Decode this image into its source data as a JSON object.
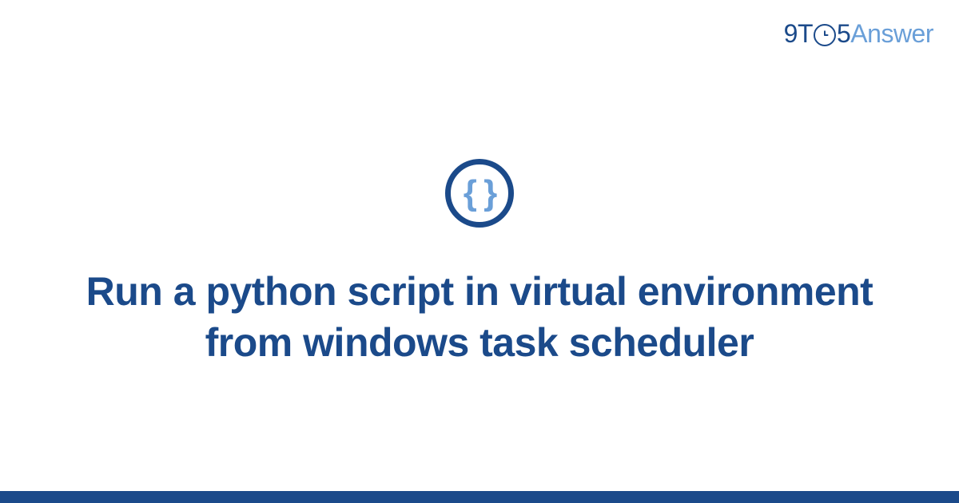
{
  "header": {
    "logo": {
      "part1": "9T",
      "clock_inner": "O",
      "part2": "5",
      "part3": "Answer"
    }
  },
  "icon": {
    "glyph": "{ }",
    "name": "code-braces-icon"
  },
  "main": {
    "title": "Run a python script in virtual environment from windows task scheduler"
  },
  "colors": {
    "primary": "#1b4a8a",
    "accent": "#6a9fd8"
  }
}
